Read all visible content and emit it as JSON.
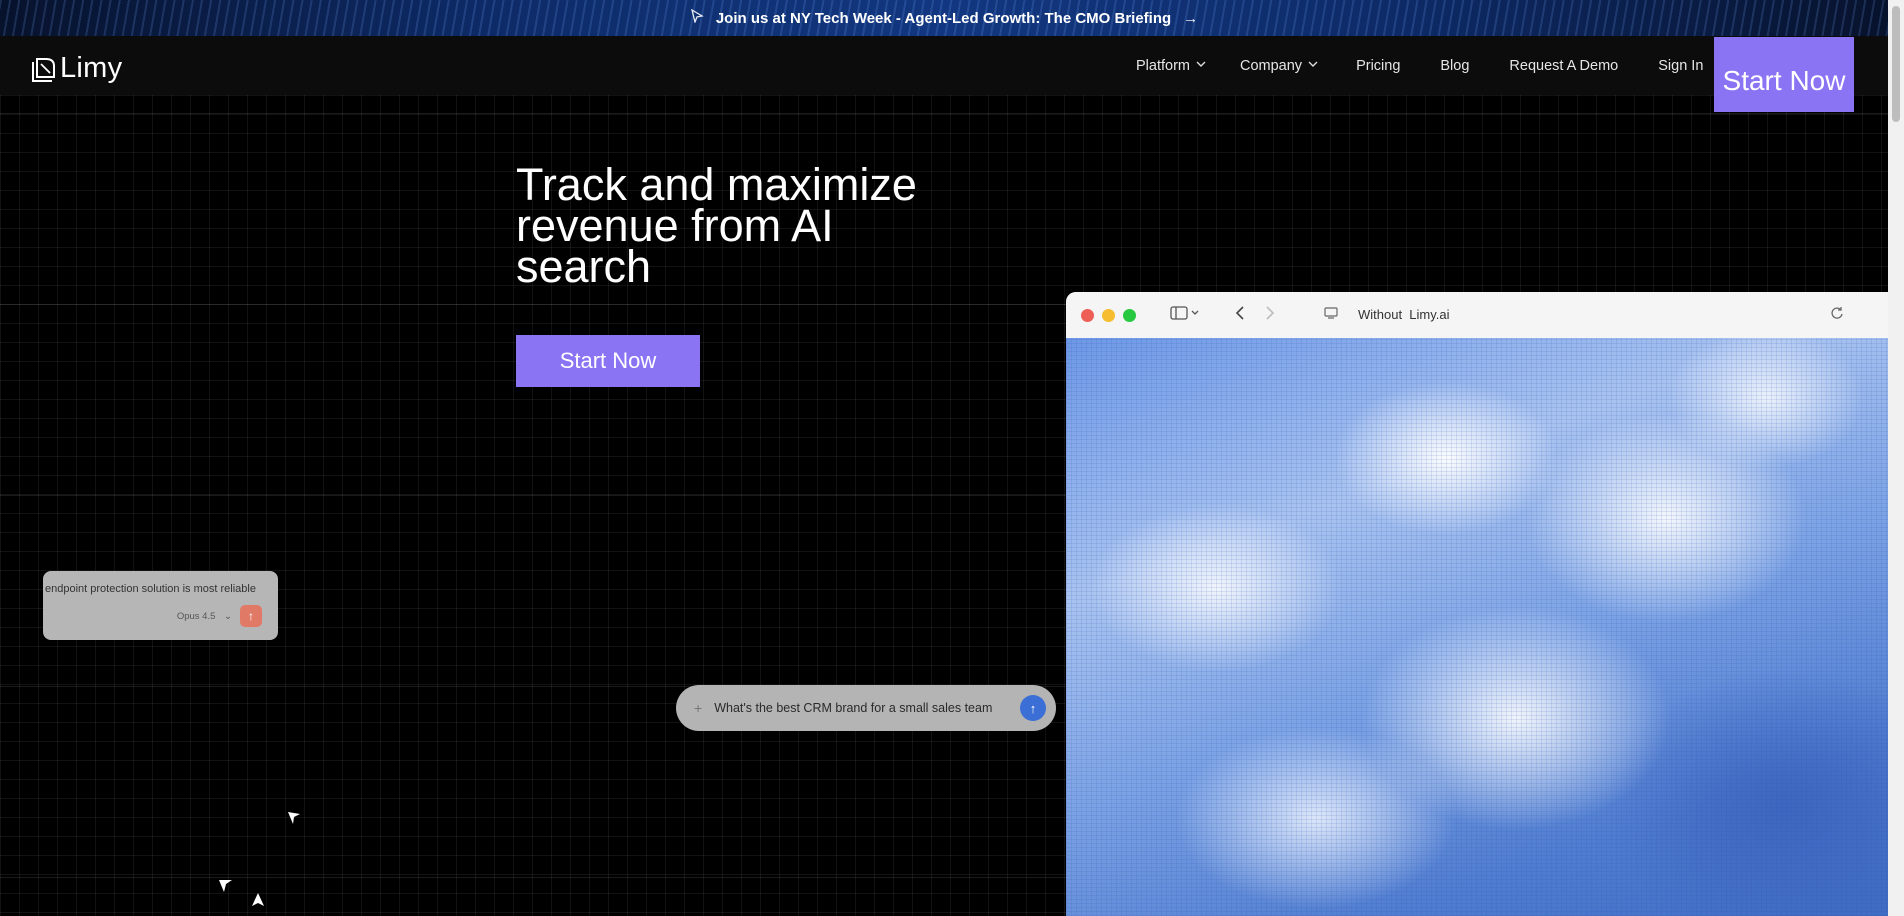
{
  "banner": {
    "text": "Join us at NY Tech Week - Agent-Led Growth: The CMO Briefing",
    "lead_icon": "cursor-arrow-icon",
    "trail_icon": "arrow-right-icon"
  },
  "nav": {
    "logo": "Limy",
    "items": [
      {
        "label": "Platform",
        "dropdown": true
      },
      {
        "label": "Company",
        "dropdown": true
      },
      {
        "label": "Pricing",
        "dropdown": false
      },
      {
        "label": "Blog",
        "dropdown": false
      },
      {
        "label": "Request A Demo",
        "dropdown": false
      },
      {
        "label": "Sign In",
        "dropdown": false
      }
    ],
    "cta": "Start Now"
  },
  "hero": {
    "title": "Track and maximize revenue from AI search",
    "cta": "Start Now"
  },
  "chat_card": {
    "text": "endpoint protection solution is most reliable",
    "model": "Opus 4.5"
  },
  "prompt_pill": {
    "text": "What's the best CRM brand for a small sales team"
  },
  "browser": {
    "url": "Without  Limy.ai"
  },
  "colors": {
    "accent": "#8a74f3",
    "background": "#000000",
    "send_blue": "#3b6fd6",
    "send_red": "#e07a67"
  }
}
